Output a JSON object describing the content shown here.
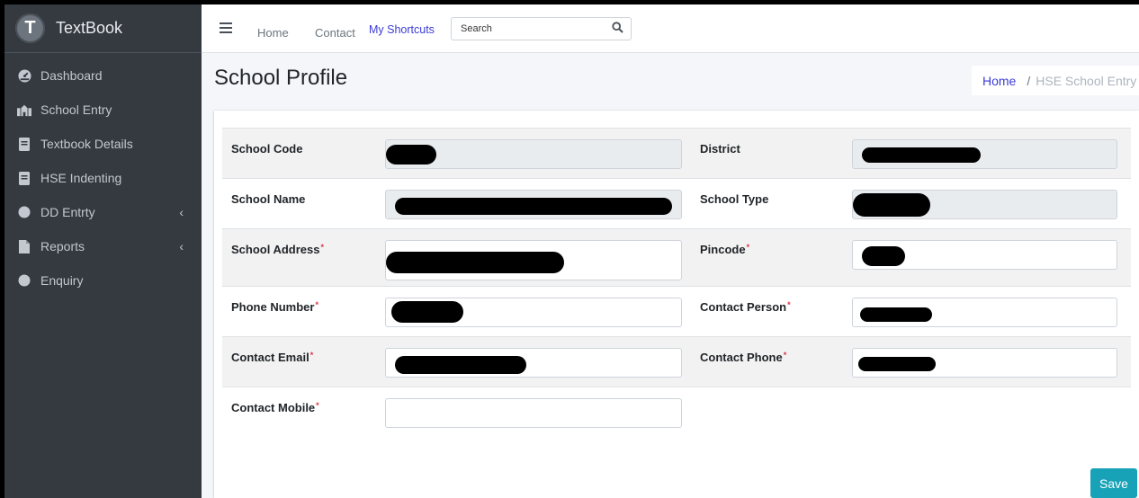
{
  "brand": {
    "name": "TextBook",
    "logo_letter": "T"
  },
  "sidebar": {
    "items": [
      {
        "label": "Dashboard"
      },
      {
        "label": "School Entry"
      },
      {
        "label": "Textbook Details"
      },
      {
        "label": "HSE Indenting"
      },
      {
        "label": "DD Entrty"
      },
      {
        "label": "Reports"
      },
      {
        "label": "Enquiry"
      }
    ],
    "chevron": "‹"
  },
  "topnav": {
    "home": "Home",
    "contact": "Contact",
    "shortcuts": "My Shortcuts",
    "search_placeholder": "Search"
  },
  "page": {
    "title": "School Profile",
    "breadcrumb": {
      "home": "Home",
      "separator": "/",
      "current": "HSE School Entry"
    }
  },
  "form": {
    "required_mark": "*",
    "school_code": "School Code",
    "district": "District",
    "school_name": "School Name",
    "school_type": "School Type",
    "school_address": "School Address",
    "pincode": "Pincode",
    "phone_number": "Phone Number",
    "contact_person": "Contact Person",
    "contact_email": "Contact Email",
    "contact_phone": "Contact Phone",
    "contact_mobile": "Contact Mobile",
    "save": "Save"
  },
  "colors": {
    "sidebar_bg": "#343a40",
    "accent": "#17a2b8",
    "link": "#3b3bd6",
    "required": "#dc3545"
  }
}
